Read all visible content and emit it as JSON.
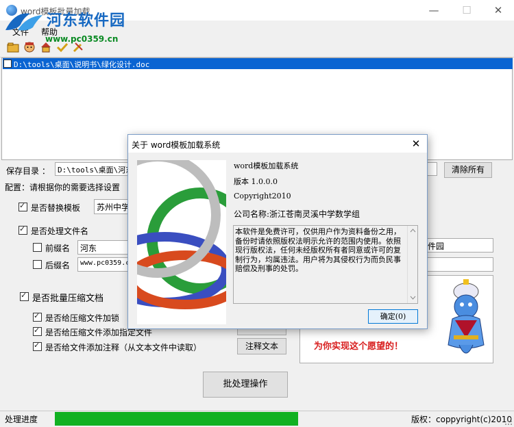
{
  "window": {
    "title": "word模板批量加载",
    "minimize_glyph": "—",
    "maximize_glyph": "☐",
    "close_glyph": "✕"
  },
  "watermark": {
    "title": "河东软件园",
    "url": "www.pc0359.cn"
  },
  "menu": {
    "items": [
      "文件",
      "帮助"
    ]
  },
  "toolbar": {
    "icons": [
      "open-folder-icon",
      "face-icon",
      "home-icon",
      "check-icon",
      "tools-icon"
    ]
  },
  "file_list": {
    "items": [
      {
        "checked": false,
        "path": "D:\\tools\\桌面\\说明书\\绿化设计.doc",
        "selected": true
      }
    ]
  },
  "form": {
    "save_dir_label": "保存目录 ：",
    "save_dir_value": "D:\\tools\\桌面\\河东",
    "clear_all_label": "清除所有",
    "config_label": "配置：请根据你的需要选择设置",
    "replace_template_label": "是否替换模板",
    "replace_template_checked": true,
    "template_value": "苏州中学",
    "process_filename_label": "是否处理文件名",
    "process_filename_checked": true,
    "prefix_label": "前缀名",
    "prefix_checked": false,
    "prefix_value": "河东",
    "suffix_label": "后缀名",
    "suffix_checked": false,
    "suffix_value": "www.pc0359.c",
    "right_field1_value": "件园",
    "right_field2_value": "",
    "compress_label": "是否批量压缩文档",
    "compress_checked": true,
    "encrypt_label": "是否给压缩文件加锁",
    "encrypt_checked": true,
    "add_file_label": "是否给压缩文件添加指定文件",
    "add_file_checked": true,
    "add_file_button": "",
    "comment_label": "是否给文件添加注释（从文本文件中读取）",
    "comment_checked": true,
    "comment_button": "注释文本"
  },
  "ad": {
    "text": "为你实现这个愿望的！"
  },
  "batch_button": "批处理操作",
  "status": {
    "progress_label": "处理进度",
    "progress_fraction": 0.48,
    "copyright": "版权：coppyright(c)2010"
  },
  "dialog": {
    "title": "关于 word模板加载系统",
    "close_glyph": "✕",
    "app_name": "word模板加载系统",
    "version": "版本 1.0.0.0",
    "copyright": "Copyright2010",
    "company": "公司名称:浙江苍南灵溪中学数学组",
    "license": "本软件是免费许可，仅供用户作为资料备份之用，备份时请依照版权法明示允许的范围内使用。依照现行版权法，任何未经版权所有者同意或许可的复制行为，均属违法。用户将为其侵权行为而负民事赔偿及刑事的处罚。",
    "ok_button": "确定(0)"
  },
  "colors": {
    "selection": "#0a64d2",
    "progress": "#11b122",
    "watermark_blue": "#1769c2",
    "watermark_green": "#0a8a23",
    "ad_red": "#d81e1e"
  }
}
